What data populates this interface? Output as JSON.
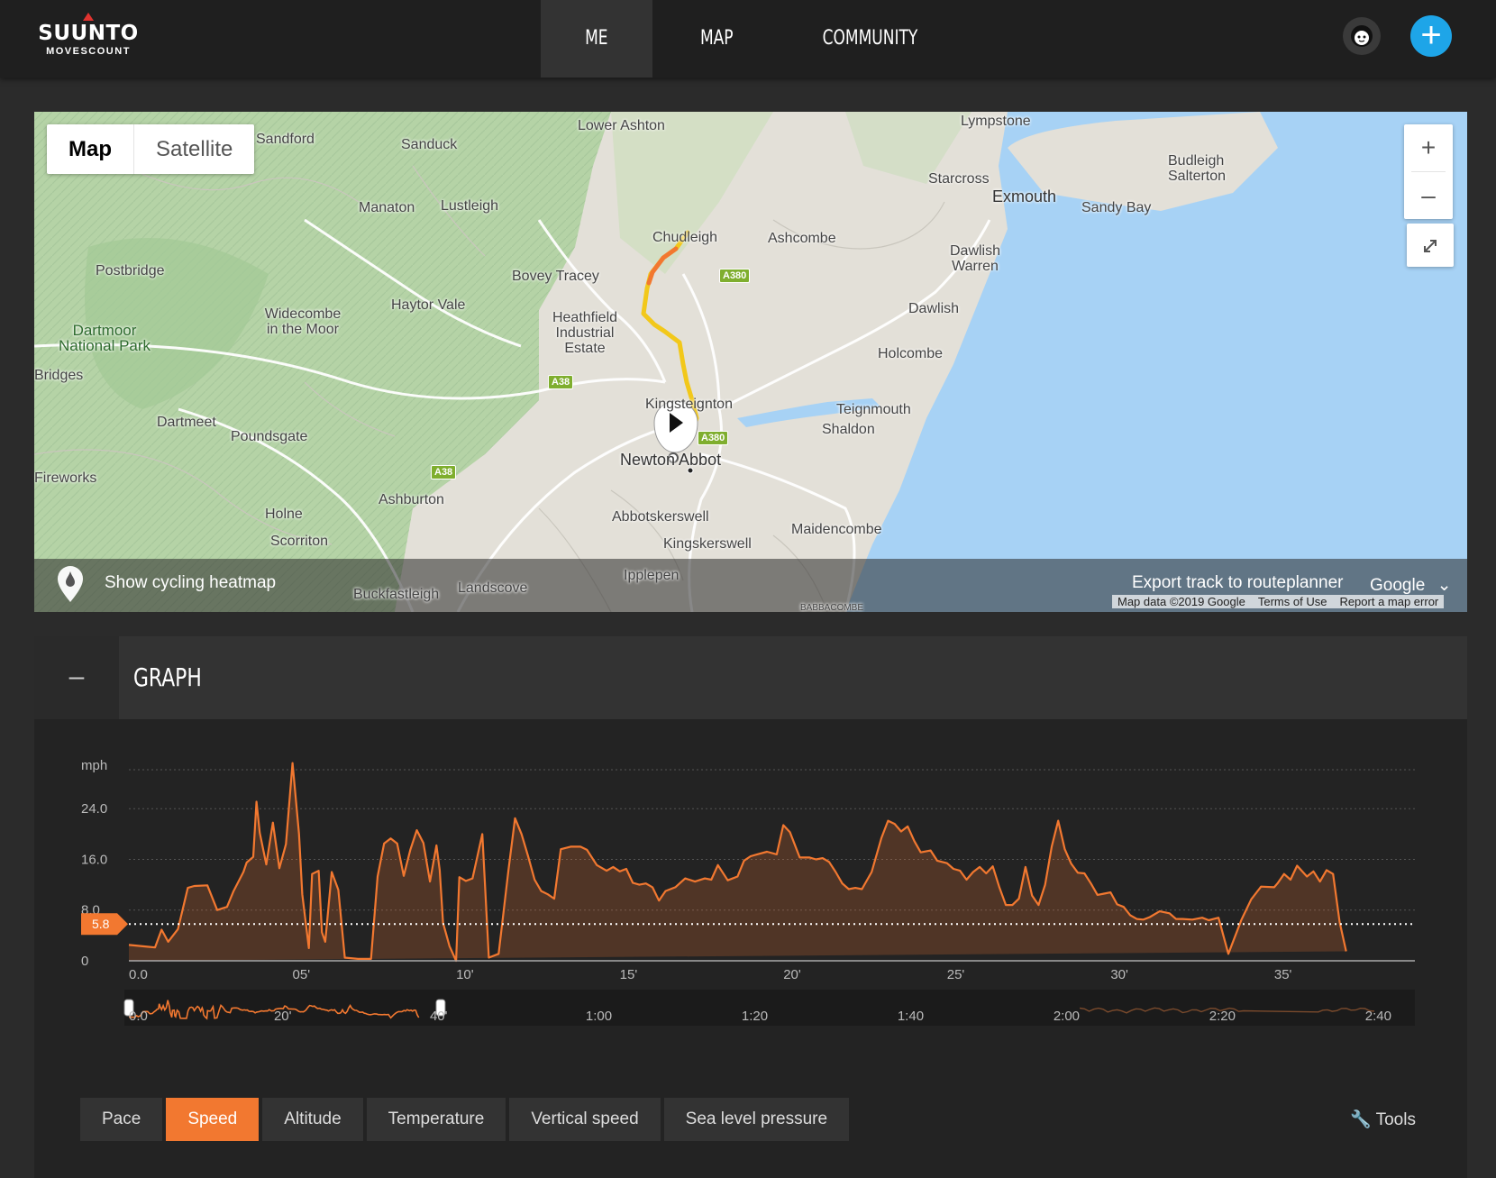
{
  "brand": {
    "name": "SUUNTO",
    "sub": "MOVESCOUNT"
  },
  "nav": {
    "items": [
      "ME",
      "MAP",
      "COMMUNITY"
    ]
  },
  "header": {
    "add_label": "+"
  },
  "map": {
    "toggle": {
      "map": "Map",
      "satellite": "Satellite"
    },
    "zoom_in": "+",
    "zoom_out": "–",
    "labels": [
      "Sandford",
      "Sanduck",
      "Lower Ashton",
      "Lympstone",
      "Starcross",
      "Exmouth",
      "Budleigh Salterton",
      "Sandy Bay",
      "Manaton",
      "Lustleigh",
      "Chudleigh",
      "Ashcombe",
      "Dawlish Warren",
      "Postbridge",
      "Bovey Tracey",
      "Haytor Vale",
      "Widecombe in the Moor",
      "Heathfield Industrial Estate",
      "Dawlish",
      "Dartmoor National Park",
      "Holcombe",
      "Bridges",
      "Kingsteignton",
      "Teignmouth",
      "Shaldon",
      "Dartmeet",
      "Poundsgate",
      "Newton Abbot",
      "Fireworks",
      "Ashburton",
      "Holne",
      "Abbotskerswell",
      "Maidencombe",
      "Scorriton",
      "Kingskerswell",
      "Ipplepen",
      "Buckfastleigh",
      "Landscove",
      "BABBACOMBE"
    ],
    "roads": [
      "A380",
      "A38",
      "A38",
      "A380"
    ],
    "heatmap_label": "Show cycling heatmap",
    "export_label": "Export track to routeplanner",
    "provider_select": "Google",
    "attribution": [
      "Map data ©2019 Google",
      "Terms of Use",
      "Report a map error"
    ],
    "google_mark": "Google"
  },
  "graph": {
    "collapse_label": "–",
    "title": "GRAPH",
    "tabs": [
      "Pace",
      "Speed",
      "Altitude",
      "Temperature",
      "Vertical speed",
      "Sea level pressure"
    ],
    "active_tab": "Speed",
    "tools_label": "Tools"
  },
  "colors": {
    "accent": "#f27830",
    "blue": "#1ea5e8",
    "water": "#a7d2f5"
  },
  "chart_data": {
    "type": "area",
    "ylabel": "mph",
    "yticks": [
      0,
      8.0,
      16.0,
      24.0
    ],
    "ytick_labels": [
      "0",
      "8.0",
      "16.0",
      "24.0"
    ],
    "ylim": [
      0,
      31
    ],
    "xlim": [
      0,
      39.3
    ],
    "xticks": [
      0,
      5,
      10,
      15,
      20,
      25,
      30,
      35
    ],
    "xtick_labels": [
      "0.0",
      "05'",
      "10'",
      "15'",
      "20'",
      "25'",
      "30'",
      "35'"
    ],
    "marker_value": 5.8,
    "marker_label": "5.8",
    "x": [
      0,
      0.6,
      0.8,
      1,
      1.2,
      1.5,
      1.8,
      2,
      2.4,
      2.7,
      3,
      3.2,
      3.5,
      3.6,
      3.8,
      3.9,
      4,
      4.2,
      4.4,
      4.6,
      4.8,
      5,
      5.2,
      5.3,
      5.5,
      5.6,
      5.8,
      5.9,
      6,
      6.2,
      6.4,
      6.6,
      7,
      7.2,
      7.4,
      7.6,
      7.8,
      8,
      8.2,
      8.4,
      8.6,
      8.8,
      9,
      9.2,
      9.4,
      9.5,
      9.6,
      9.8,
      10,
      10.1,
      10.3,
      10.5,
      10.8,
      11,
      11.3,
      11.6,
      11.8,
      12,
      12.2,
      12.4,
      12.6,
      12.8,
      13,
      13.2,
      13.5,
      13.8,
      14,
      14.3,
      14.6,
      14.8,
      15,
      15.2,
      15.4,
      15.6,
      15.8,
      16,
      16.2,
      16.4,
      16.7,
      17,
      17.3,
      17.6,
      17.8,
      18,
      18.3,
      18.6,
      18.8,
      19,
      19.2,
      19.5,
      19.8,
      20,
      20.2,
      20.5,
      20.8,
      21,
      21.2,
      21.4,
      21.6,
      21.8,
      22,
      22.2,
      22.4,
      22.7,
      23,
      23.2,
      23.4,
      23.6,
      23.8,
      24,
      24.2,
      24.5,
      24.7,
      25,
      25.2,
      25.4,
      25.6,
      25.8,
      26,
      26.2,
      26.4,
      26.6,
      26.8,
      27,
      27.2,
      27.4,
      27.6,
      27.8,
      28,
      28.2,
      28.4,
      28.6,
      28.8,
      29,
      29.2,
      29.4,
      29.6,
      29.8,
      30,
      30.2,
      30.4,
      30.6,
      30.8,
      31,
      31.2,
      31.5,
      31.8,
      32,
      32.2,
      32.5,
      32.8,
      33,
      33.3,
      33.6,
      34,
      34.3,
      34.6,
      35,
      35.1,
      35.3,
      35.5,
      35.7,
      36,
      36.2,
      36.4,
      36.6,
      36.8,
      37,
      37.2,
      37.4,
      37.6,
      37.8,
      38,
      38.2
    ],
    "y": [
      2.5,
      2.2,
      2.1,
      4.9,
      3,
      5,
      11.5,
      11.8,
      11.9,
      8,
      8.5,
      11,
      14,
      15.5,
      16.4,
      25.1,
      20.2,
      15.2,
      21.8,
      14.6,
      18.4,
      31.2,
      20,
      10.5,
      2,
      13.7,
      14.2,
      4.5,
      3,
      14,
      11.2,
      0.5,
      0.3,
      0.3,
      0.3,
      13.3,
      18.5,
      19.3,
      18.5,
      13.4,
      17.5,
      20.6,
      18.6,
      12.5,
      18.2,
      14.3,
      6,
      2.3,
      0,
      13.2,
      12.6,
      13,
      20,
      0.5,
      1.1,
      14.3,
      22.5,
      20,
      16.5,
      12.8,
      11,
      10.5,
      9.8,
      17.6,
      18,
      18,
      17.5,
      15.1,
      14.2,
      14.8,
      14.1,
      14.5,
      12.3,
      12,
      12.2,
      11.6,
      9.5,
      11,
      11.6,
      13,
      12.5,
      13,
      12.8,
      15.1,
      12.7,
      13.3,
      15.8,
      16.5,
      16.8,
      17.2,
      16.8,
      21.4,
      20.3,
      16.3,
      16.3,
      16,
      16.2,
      15.6,
      14,
      12.2,
      11.3,
      11.5,
      11.3,
      14,
      19.4,
      22.1,
      21.6,
      20.4,
      21.2,
      18.9,
      17.1,
      17.4,
      15.8,
      15.4,
      14.5,
      14.2,
      12.8,
      14,
      14.8,
      13.8,
      14.9,
      11.6,
      8.8,
      8.8,
      9.8,
      14.8,
      10.3,
      8.8,
      12,
      18,
      22.1,
      17.6,
      15.3,
      13.9,
      13.8,
      12.2,
      10.4,
      10.6,
      10.8,
      8.9,
      8.5,
      7.2,
      6.6,
      6.5,
      6.9,
      7.8,
      7.5,
      6.6,
      6.6,
      6.5,
      6.8,
      6.4,
      6.8,
      1.1,
      6.5,
      9.7,
      11.7,
      11.6,
      12.2,
      13.7,
      12.8,
      15,
      13.3,
      14.1,
      12.5,
      14.3,
      13.7,
      6.1,
      1.5
    ]
  },
  "overview": {
    "tick_labels": [
      "0.0",
      "20'",
      "40'",
      "1:00",
      "1:20",
      "1:40",
      "2:00",
      "2:20",
      "2:40"
    ]
  }
}
